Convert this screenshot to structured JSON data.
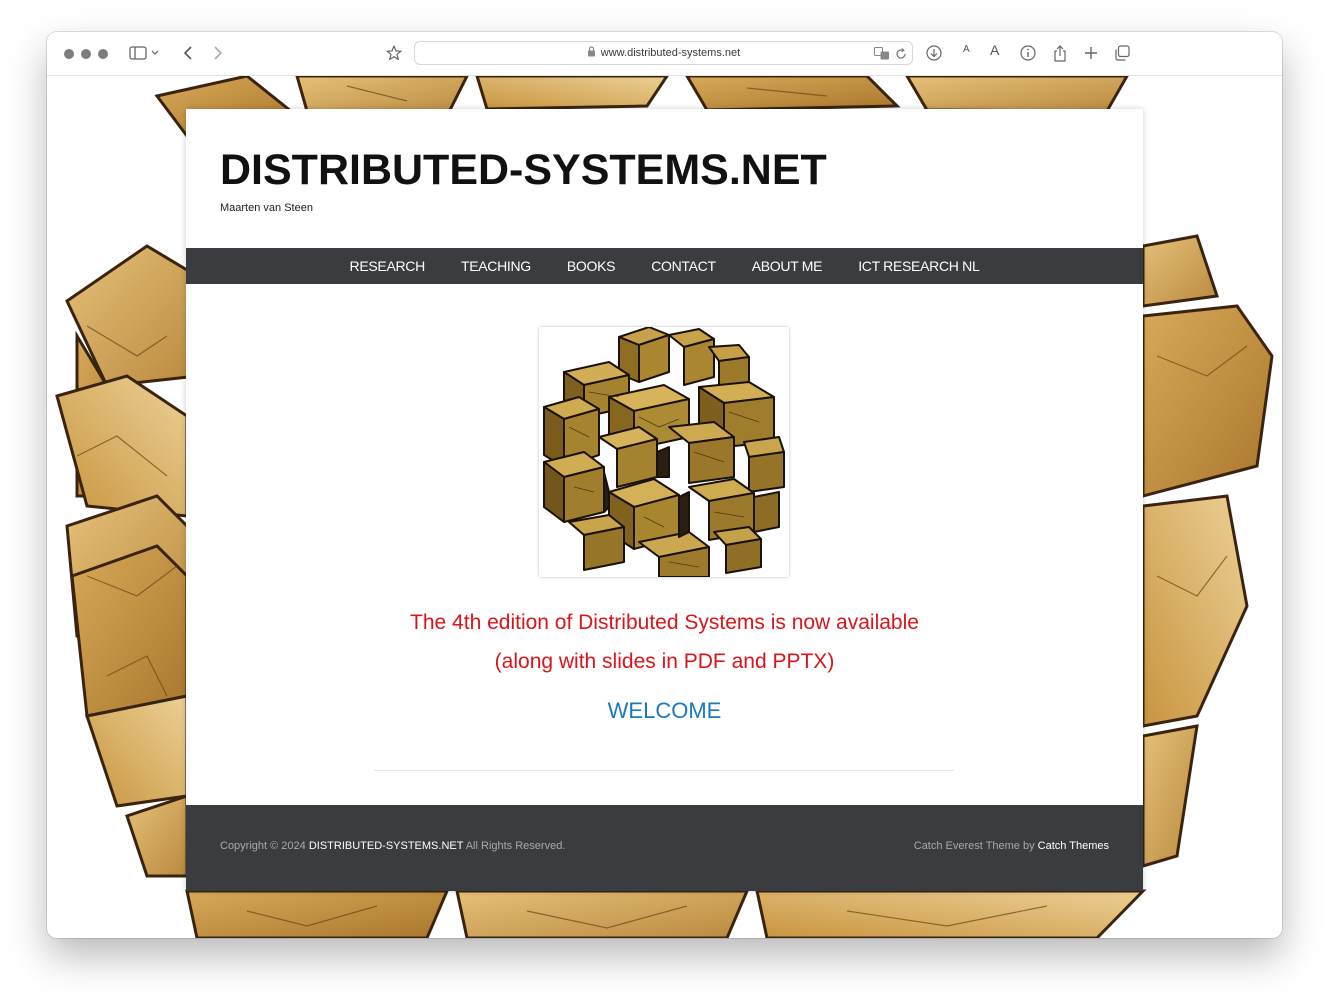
{
  "browser": {
    "url": "www.distributed-systems.net",
    "text_size_small": "A",
    "text_size_large": "A"
  },
  "site": {
    "title": "DISTRIBUTED-SYSTEMS.NET",
    "tagline": "Maarten van Steen",
    "nav": [
      "RESEARCH",
      "TEACHING",
      "BOOKS",
      "CONTACT",
      "ABOUT ME",
      "ICT RESEARCH NL"
    ],
    "announcement_line1": "The 4th edition of Distributed Systems is now available",
    "announcement_line2": "(along with slides in PDF and PPTX)",
    "welcome": "WELCOME"
  },
  "footer": {
    "copyright_prefix": "Copyright © 2024",
    "copyright_site": "DISTRIBUTED-SYSTEMS.NET",
    "copyright_suffix": "All Rights Reserved.",
    "theme_prefix": "Catch Everest Theme by",
    "theme_link": "Catch Themes"
  },
  "colors": {
    "nav_bg": "#3b3c3f",
    "announcement": "#d9151b",
    "welcome_link": "#1b79c0",
    "wood": "#c99a4c"
  }
}
